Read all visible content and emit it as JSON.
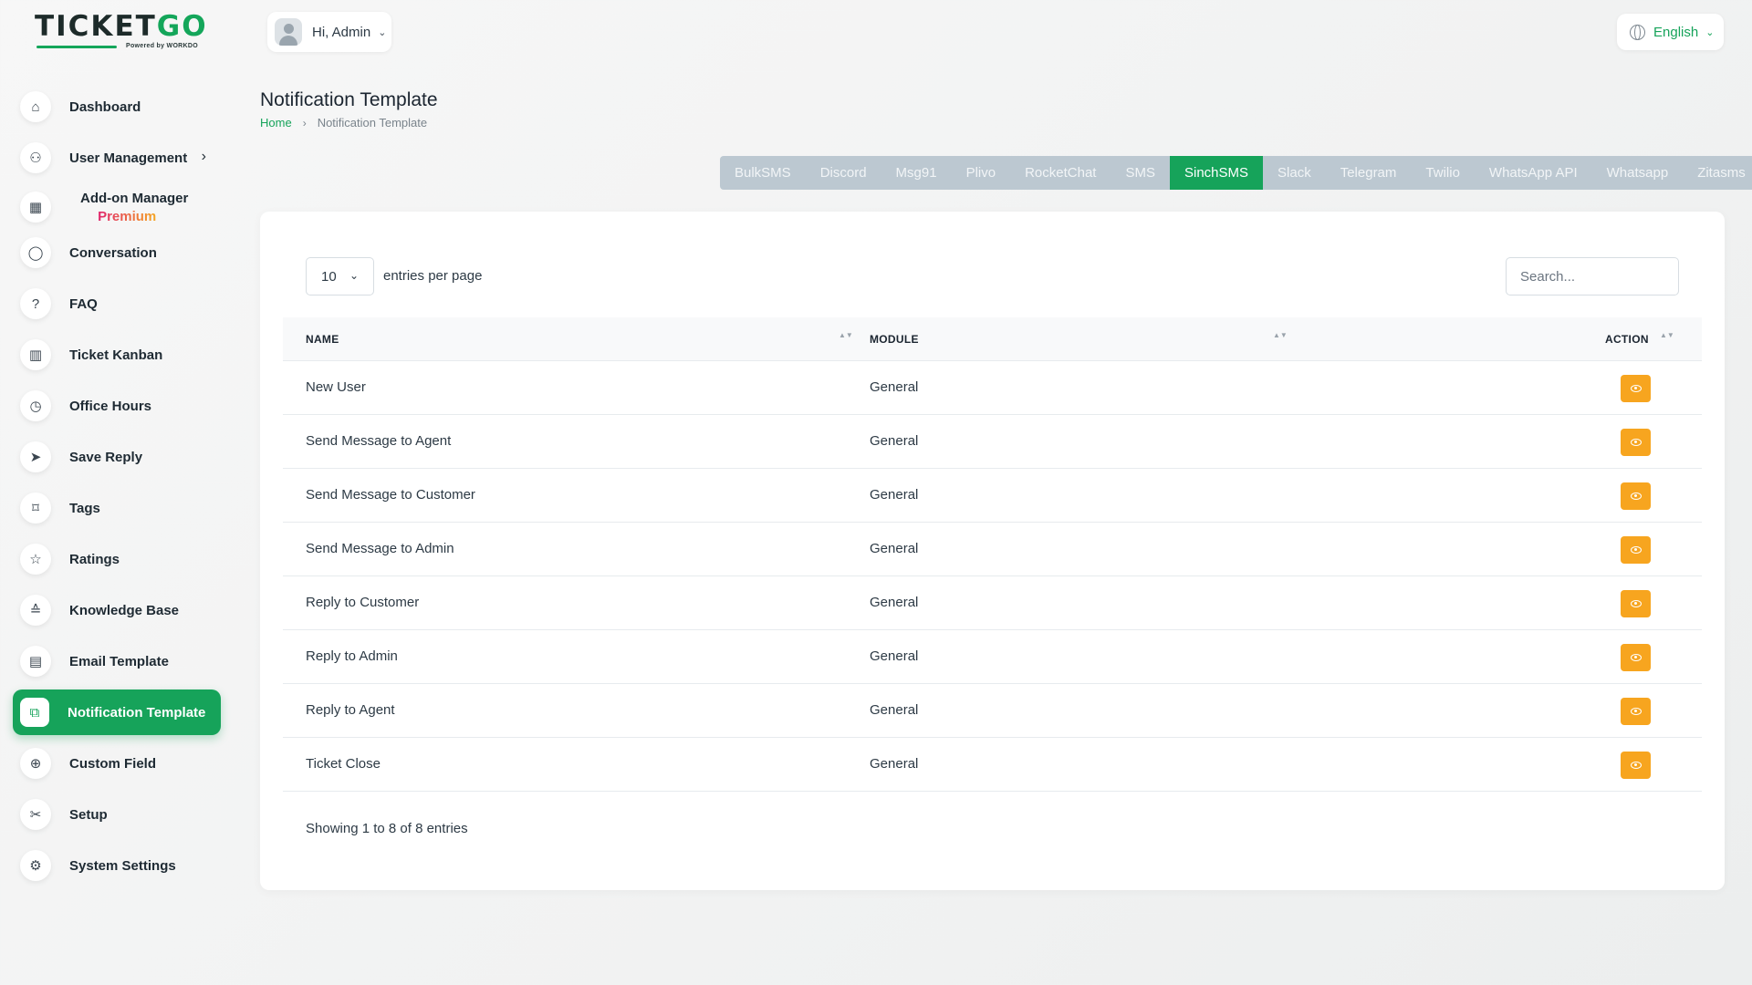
{
  "brand": {
    "logo_main": "TICKET",
    "logo_accent": "GO",
    "logo_sub": "Powered by WORKDO"
  },
  "header": {
    "user_greeting": "Hi, Admin",
    "language": "English"
  },
  "sidebar": {
    "items": [
      {
        "label": "Dashboard",
        "icon": "home-icon",
        "glyph": "⌂"
      },
      {
        "label": "User Management",
        "icon": "users-icon",
        "glyph": "⚇",
        "chevron": "›"
      },
      {
        "label": "Add-on Manager",
        "icon": "grid-icon",
        "glyph": "▦",
        "badge": "Premium"
      },
      {
        "label": "Conversation",
        "icon": "chat-icon",
        "glyph": "◯"
      },
      {
        "label": "FAQ",
        "icon": "question-icon",
        "glyph": "?"
      },
      {
        "label": "Ticket Kanban",
        "icon": "kanban-icon",
        "glyph": "▥"
      },
      {
        "label": "Office Hours",
        "icon": "clock-icon",
        "glyph": "◷"
      },
      {
        "label": "Save Reply",
        "icon": "send-icon",
        "glyph": "➤"
      },
      {
        "label": "Tags",
        "icon": "tag-icon",
        "glyph": "⌑"
      },
      {
        "label": "Ratings",
        "icon": "star-icon",
        "glyph": "☆"
      },
      {
        "label": "Knowledge Base",
        "icon": "graduation-cap-icon",
        "glyph": "≙"
      },
      {
        "label": "Email Template",
        "icon": "template-icon",
        "glyph": "▤"
      },
      {
        "label": "Notification Template",
        "icon": "notification-icon",
        "glyph": "⧉"
      },
      {
        "label": "Custom Field",
        "icon": "plus-circle-icon",
        "glyph": "⊕"
      },
      {
        "label": "Setup",
        "icon": "setup-icon",
        "glyph": "✂"
      },
      {
        "label": "System Settings",
        "icon": "gear-icon",
        "glyph": "⚙"
      }
    ],
    "active": "Notification Template"
  },
  "page": {
    "title": "Notification Template",
    "breadcrumb": {
      "home": "Home",
      "separator": "›",
      "current": "Notification Template"
    }
  },
  "tabs": [
    {
      "label": "BulkSMS"
    },
    {
      "label": "Discord"
    },
    {
      "label": "Msg91"
    },
    {
      "label": "Plivo"
    },
    {
      "label": "RocketChat"
    },
    {
      "label": "SMS"
    },
    {
      "label": "SinchSMS",
      "active": true
    },
    {
      "label": "Slack"
    },
    {
      "label": "Telegram"
    },
    {
      "label": "Twilio"
    },
    {
      "label": "WhatsApp API"
    },
    {
      "label": "Whatsapp"
    },
    {
      "label": "Zitasms"
    }
  ],
  "table": {
    "entries_value": "10",
    "entries_label": "entries per page",
    "search_placeholder": "Search...",
    "columns": [
      "NAME",
      "MODULE",
      "ACTION"
    ],
    "rows": [
      {
        "name": "New User",
        "module": "General"
      },
      {
        "name": "Send Message to Agent",
        "module": "General"
      },
      {
        "name": "Send Message to Customer",
        "module": "General"
      },
      {
        "name": "Send Message to Admin",
        "module": "General"
      },
      {
        "name": "Reply to Customer",
        "module": "General"
      },
      {
        "name": "Reply to Admin",
        "module": "General"
      },
      {
        "name": "Reply to Agent",
        "module": "General"
      },
      {
        "name": "Ticket Close",
        "module": "General"
      }
    ],
    "action_icon": "eye-icon",
    "footer": "Showing 1 to 8 of 8 entries"
  },
  "colors": {
    "accent": "#16a35a",
    "action": "#f7a51f",
    "tabs_bg": "#bcc8d1"
  }
}
